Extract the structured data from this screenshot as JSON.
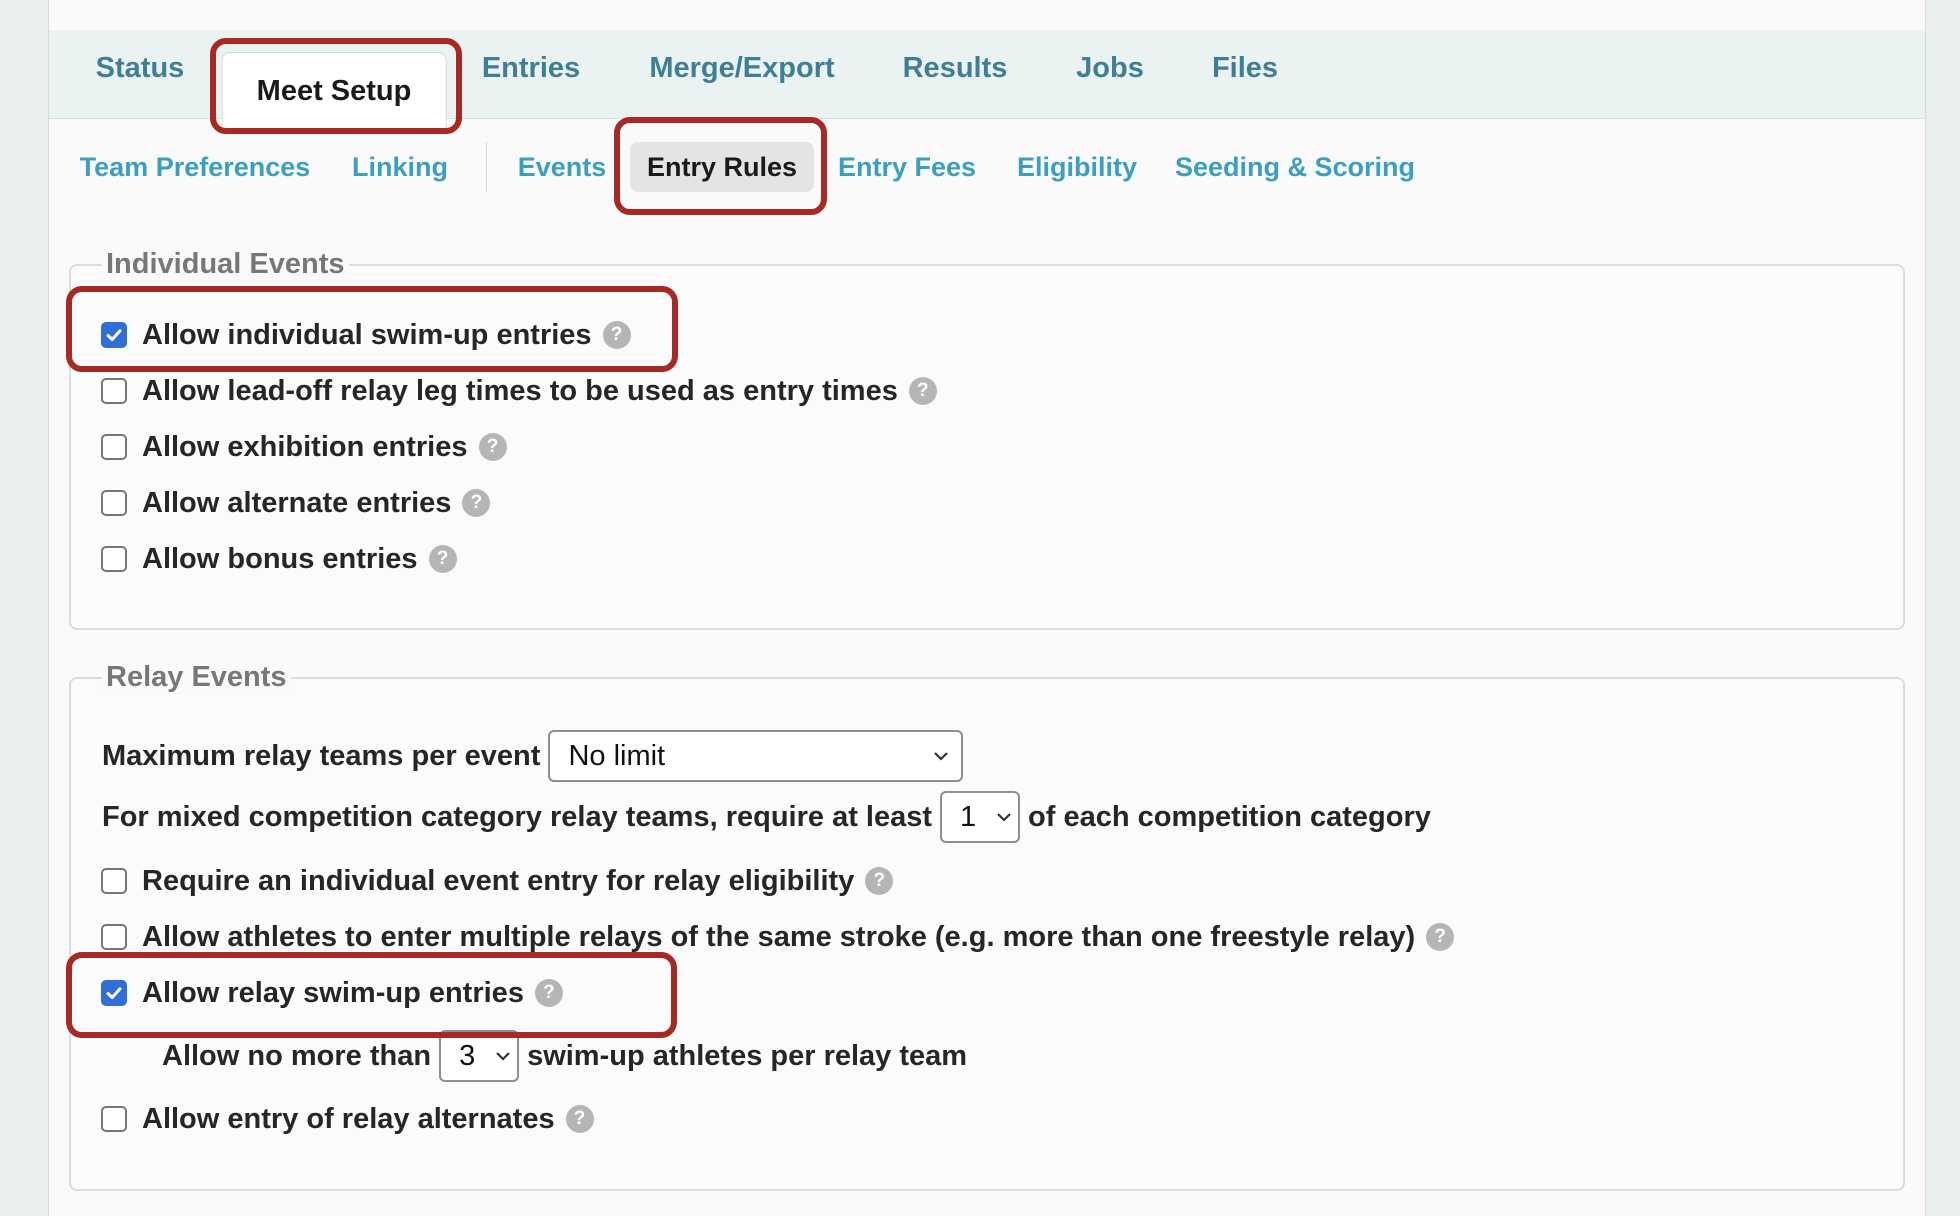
{
  "top_tabs": [
    {
      "label": "Status"
    },
    {
      "label": "Meet Setup"
    },
    {
      "label": "Entries"
    },
    {
      "label": "Merge/Export"
    },
    {
      "label": "Results"
    },
    {
      "label": "Jobs"
    },
    {
      "label": "Files"
    }
  ],
  "sub_tabs": [
    {
      "label": "Team Preferences"
    },
    {
      "label": "Linking"
    },
    {
      "label": "Events"
    },
    {
      "label": "Entry Rules"
    },
    {
      "label": "Entry Fees"
    },
    {
      "label": "Eligibility"
    },
    {
      "label": "Seeding & Scoring"
    }
  ],
  "help_glyph": "?",
  "individual": {
    "legend": "Individual Events",
    "options": [
      {
        "label": "Allow individual swim-up entries",
        "checked": true
      },
      {
        "label": "Allow lead-off relay leg times to be used as entry times",
        "checked": false
      },
      {
        "label": "Allow exhibition entries",
        "checked": false
      },
      {
        "label": "Allow alternate entries",
        "checked": false
      },
      {
        "label": "Allow bonus entries",
        "checked": false
      }
    ]
  },
  "relay": {
    "legend": "Relay Events",
    "max_teams_label": "Maximum relay teams per event",
    "max_teams_value": "No limit",
    "mixed_label_before": "For mixed competition category relay teams, require at least",
    "mixed_value": "1",
    "mixed_label_after": "of each competition category",
    "options": [
      {
        "label": "Require an individual event entry for relay eligibility",
        "checked": false
      },
      {
        "label": "Allow athletes to enter multiple relays of the same stroke (e.g. more than one freestyle relay)",
        "checked": false
      },
      {
        "label": "Allow relay swim-up entries",
        "checked": true
      }
    ],
    "swimup_before": "Allow no more than",
    "swimup_value": "3",
    "swimup_after": "swim-up athletes per relay team",
    "alternates": {
      "label": "Allow entry of relay alternates",
      "checked": false
    }
  },
  "colors": {
    "link": "#3a9fc0",
    "top_tab": "#3f7f96",
    "highlight": "#a62923",
    "checkbox_checked": "#2f6fd6"
  }
}
